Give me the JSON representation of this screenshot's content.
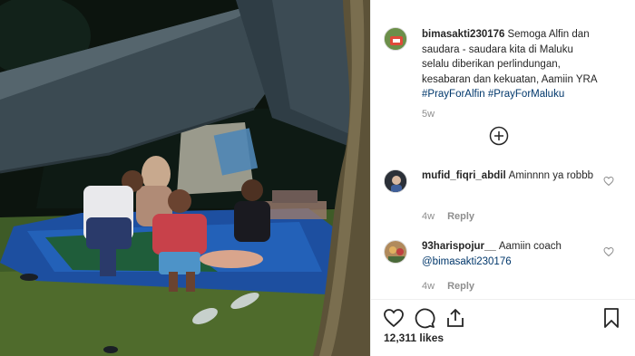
{
  "post": {
    "author": "bimasakti230176",
    "caption_text": "Semoga Alfin dan saudara - saudara kita di Maluku selalu diberikan perlindungan, kesabaran dan kekuatan, Aamiin YRA",
    "hashtags": "#PrayForAlfin #PrayForMaluku",
    "time": "5w"
  },
  "comments": [
    {
      "user": "mufid_fiqri_abdil",
      "text": "Aminnnn ya robbb",
      "time": "4w",
      "reply_label": "Reply"
    },
    {
      "user": "93harispojur__",
      "text": "Aamiin coach",
      "mention": "@bimasakti230176",
      "time": "4w",
      "reply_label": "Reply"
    }
  ],
  "actions": {
    "likes": "12,311 likes",
    "icons": [
      "heart-icon",
      "comment-icon",
      "share-icon",
      "bookmark-icon"
    ]
  },
  "colors": {
    "text": "#262626",
    "muted": "#8e8e8e",
    "link": "#00376b",
    "border": "#efefef"
  }
}
